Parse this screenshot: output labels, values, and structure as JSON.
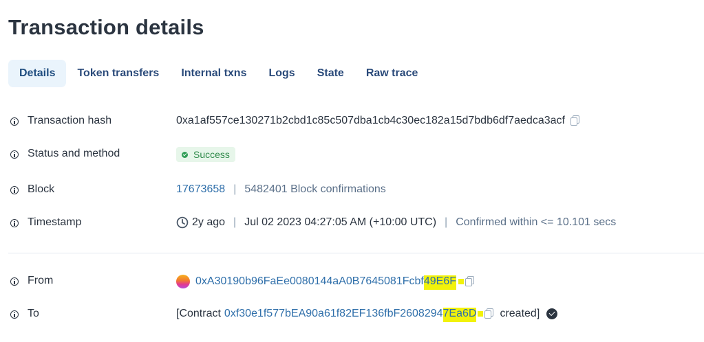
{
  "page_title": "Transaction details",
  "tabs": [
    {
      "label": "Details",
      "active": true
    },
    {
      "label": "Token transfers",
      "active": false
    },
    {
      "label": "Internal txns",
      "active": false
    },
    {
      "label": "Logs",
      "active": false
    },
    {
      "label": "State",
      "active": false
    },
    {
      "label": "Raw trace",
      "active": false
    }
  ],
  "rows": {
    "hash": {
      "label": "Transaction hash",
      "value": "0xa1af557ce130271b2cbd1c85c507dba1cb4c30ec182a15d7bdb6df7aedca3acf",
      "icon": "copy-icon"
    },
    "status": {
      "label": "Status and method",
      "badge": "Success",
      "badge_color": "#2f8a4a"
    },
    "block": {
      "label": "Block",
      "number": "17673658",
      "confirmations": "5482401 Block confirmations"
    },
    "timestamp": {
      "label": "Timestamp",
      "ago": "2y ago",
      "datetime": "Jul 02 2023 04:27:05 AM (+10:00 UTC)",
      "confirmed": "Confirmed within <= 10.101 secs"
    },
    "from": {
      "label": "From",
      "address_main": "0xA30190b96FaEe0080144aA0B7645081Fcbf",
      "address_tail": "49E6F"
    },
    "to": {
      "label": "To",
      "prefix": "[Contract",
      "address_main": "0xf30e1f577bEA90a61f82EF136fbF2608294",
      "address_tail": "7Ea6D",
      "suffix": "created]"
    }
  },
  "colors": {
    "link": "#2f6faa",
    "highlight": "#f2f20a",
    "tab_active_bg": "#eaf4fc"
  }
}
